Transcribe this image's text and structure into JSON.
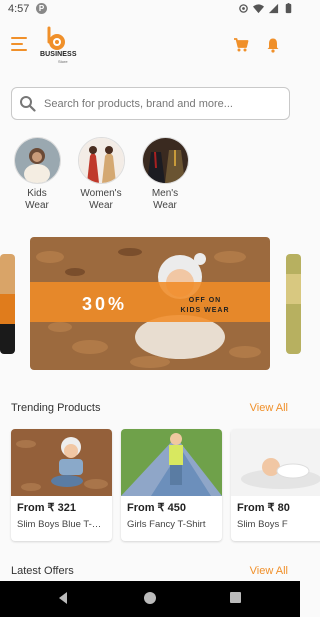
{
  "status_bar": {
    "time": "4:57",
    "app_badge": "P",
    "icons": [
      "location-icon",
      "wifi-icon",
      "signal-icon",
      "battery-icon"
    ]
  },
  "app_bar": {
    "logo_text": "BUSINESS",
    "logo_subtext": "Store",
    "icons": [
      "menu-icon",
      "cart-icon",
      "bell-icon"
    ],
    "accent_color": "#f0902a"
  },
  "search": {
    "placeholder": "Search for products, brand and more..."
  },
  "categories": [
    {
      "line1": "Kids",
      "line2": "Wear"
    },
    {
      "line1": "Women's",
      "line2": "Wear"
    },
    {
      "line1": "Men's",
      "line2": "Wear"
    }
  ],
  "banner": {
    "percent": "30%",
    "line1": "OFF ON",
    "line2": "KIDS WEAR"
  },
  "trending": {
    "title": "Trending Products",
    "view_all": "View All",
    "products": [
      {
        "price": "From ₹ 321",
        "name": "Slim Boys Blue T-Shirt"
      },
      {
        "price": "From ₹ 450",
        "name": "Girls Fancy T-Shirt"
      },
      {
        "price": "From ₹ 80",
        "name": "Slim Boys F"
      }
    ]
  },
  "latest_offers": {
    "title": "Latest Offers",
    "view_all": "View All"
  },
  "nav_bar": {
    "buttons": [
      "back-icon",
      "home-icon",
      "recents-icon"
    ]
  }
}
